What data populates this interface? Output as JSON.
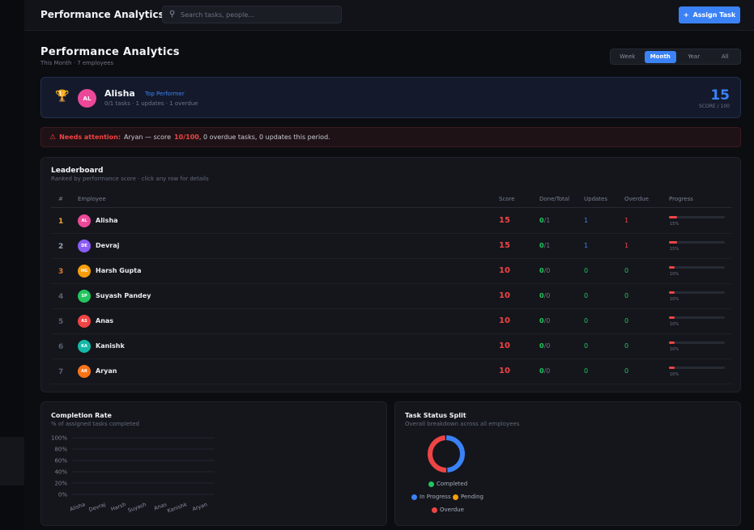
{
  "header": {
    "title": "Performance Analytics",
    "search_placeholder": "Search tasks, people...",
    "assign_label": "Assign Task"
  },
  "page": {
    "title": "Performance Analytics",
    "subtitle": "This Month · 7 employees"
  },
  "range_tabs": [
    {
      "label": "Week",
      "active": false
    },
    {
      "label": "Month",
      "active": true
    },
    {
      "label": "Year",
      "active": false
    },
    {
      "label": "All",
      "active": false
    }
  ],
  "top_performer": {
    "initials": "AL",
    "name": "Alisha",
    "badge": "Top Performer",
    "meta": "0/1 tasks · 1 updates · 1 overdue",
    "score": "15",
    "score_label": "SCORE / 100"
  },
  "alert": {
    "label": "Needs attention:",
    "pre": "Aryan — score",
    "score": "10/100",
    "post": ", 0 overdue tasks, 0 updates this period."
  },
  "leaderboard": {
    "title": "Leaderboard",
    "subtitle": "Ranked by performance score · click any row for details",
    "headers": [
      "#",
      "Employee",
      "Score",
      "Done/Total",
      "Updates",
      "Overdue",
      "Progress"
    ],
    "rows": [
      {
        "rank": "1",
        "initials": "AL",
        "name": "Alisha",
        "color": "#ec4899",
        "score": "15",
        "done": "0",
        "total": "/1",
        "updates": "1",
        "overdue": "1",
        "progress": 0.15,
        "pct": "15%"
      },
      {
        "rank": "2",
        "initials": "DE",
        "name": "Devraj",
        "color": "#8b5cf6",
        "score": "15",
        "done": "0",
        "total": "/1",
        "updates": "1",
        "overdue": "1",
        "progress": 0.15,
        "pct": "15%"
      },
      {
        "rank": "3",
        "initials": "HG",
        "name": "Harsh Gupta",
        "color": "#f59e0b",
        "score": "10",
        "done": "0",
        "total": "/0",
        "updates": "0",
        "overdue": "0",
        "progress": 0.1,
        "pct": "10%"
      },
      {
        "rank": "4",
        "initials": "SP",
        "name": "Suyash Pandey",
        "color": "#22c55e",
        "score": "10",
        "done": "0",
        "total": "/0",
        "updates": "0",
        "overdue": "0",
        "progress": 0.1,
        "pct": "10%"
      },
      {
        "rank": "5",
        "initials": "AS",
        "name": "Anas",
        "color": "#ef4444",
        "score": "10",
        "done": "0",
        "total": "/0",
        "updates": "0",
        "overdue": "0",
        "progress": 0.1,
        "pct": "10%"
      },
      {
        "rank": "6",
        "initials": "KA",
        "name": "Kanishk",
        "color": "#14b8a6",
        "score": "10",
        "done": "0",
        "total": "/0",
        "updates": "0",
        "overdue": "0",
        "progress": 0.1,
        "pct": "10%"
      },
      {
        "rank": "7",
        "initials": "AR",
        "name": "Aryan",
        "color": "#f97316",
        "score": "10",
        "done": "0",
        "total": "/0",
        "updates": "0",
        "overdue": "0",
        "progress": 0.1,
        "pct": "10%"
      }
    ]
  },
  "colors": {
    "accent": "#3b82f6",
    "danger": "#ef4444",
    "success": "#22c55e",
    "warning": "#f59e0b",
    "rank_gold": "#f5a524",
    "rank_silver": "#9aa3b5",
    "rank_bronze": "#e07a2e",
    "rank_other": "#5a6070"
  },
  "chart_data": [
    {
      "type": "bar",
      "title": "Completion Rate",
      "subtitle": "% of assigned tasks completed",
      "categories": [
        "Alisha",
        "Devraj",
        "Harsh",
        "Suyash",
        "Anas",
        "Kanishk",
        "Aryan"
      ],
      "values": [
        0,
        0,
        0,
        0,
        0,
        0,
        0
      ],
      "ylim": [
        0,
        100
      ],
      "y_ticks": [
        "0%",
        "20%",
        "40%",
        "60%",
        "80%",
        "100%"
      ],
      "grid": true
    },
    {
      "type": "pie",
      "title": "Task Status Split",
      "subtitle": "Overall breakdown across all employees",
      "donut": true,
      "slices": [
        {
          "label": "Completed",
          "value": 0,
          "color": "#22c55e"
        },
        {
          "label": "In Progress",
          "value": 1,
          "color": "#3b82f6"
        },
        {
          "label": "Pending",
          "value": 0,
          "color": "#f59e0b"
        },
        {
          "label": "Overdue",
          "value": 1,
          "color": "#ef4444"
        }
      ],
      "legend_position": "bottom"
    }
  ]
}
